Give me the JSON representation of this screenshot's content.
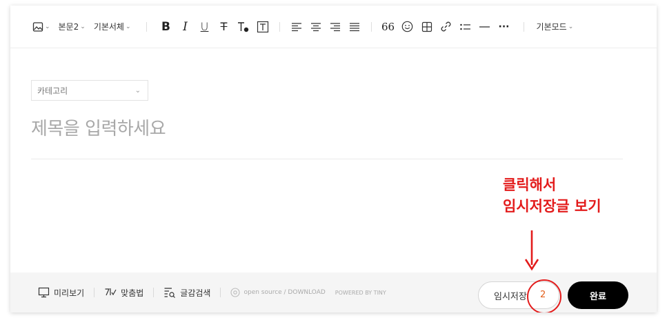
{
  "toolbar": {
    "paragraph_style": "본문2",
    "font_family": "기본서체",
    "mode": "기본모드",
    "caret": "⌄",
    "icons": [
      "image-icon",
      "bold-icon",
      "italic-icon",
      "underline-icon",
      "strikethrough-icon",
      "text-color-icon",
      "text-background-icon",
      "align-left-icon",
      "align-center-icon",
      "align-right-icon",
      "align-justify-icon",
      "quote-icon",
      "emoji-icon",
      "table-icon",
      "link-icon",
      "list-icon",
      "divider-icon",
      "more-icon"
    ],
    "bold": "B",
    "italic": "I",
    "underline": "U",
    "strike": "T",
    "quote": "66",
    "more": "···"
  },
  "editor": {
    "category_placeholder": "카테고리",
    "title_placeholder": "제목을 입력하세요"
  },
  "annotation": {
    "line1": "클릭해서",
    "line2": "임시저장글 보기",
    "color": "#e31b1b"
  },
  "bottom": {
    "preview": "미리보기",
    "spellcheck": "맞춤법",
    "text_search": "글감검색",
    "open_source": "open source / DOWNLOAD",
    "powered": "POWERED BY TINY"
  },
  "actions": {
    "draft_label": "임시저장",
    "draft_count": "2",
    "done_label": "완료"
  }
}
